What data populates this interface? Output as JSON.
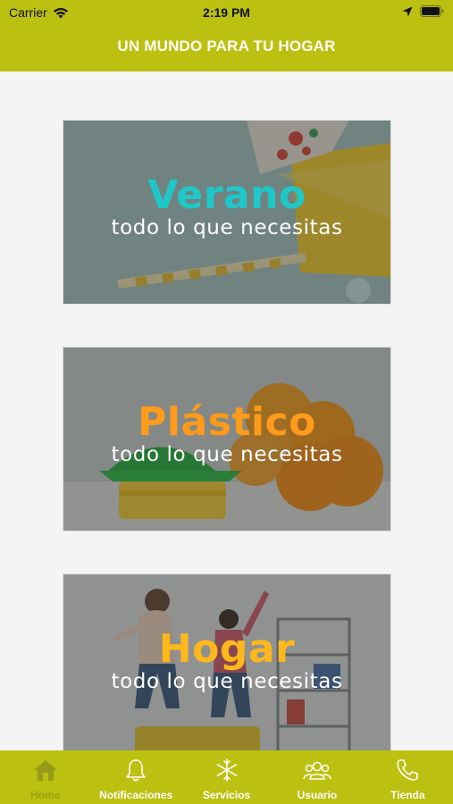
{
  "status": {
    "carrier": "Carrier",
    "time": "2:19 PM"
  },
  "header": {
    "title": "UN MUNDO PARA TU HOGAR"
  },
  "cards": [
    {
      "title": "Verano",
      "subtitle": "todo lo que necesitas",
      "title_color": "#1ec8c8"
    },
    {
      "title": "Plástico",
      "subtitle": "todo lo que necesitas",
      "title_color": "#ff9a1a"
    },
    {
      "title": "Hogar",
      "subtitle": "todo lo que necesitas",
      "title_color": "#ffb81c"
    }
  ],
  "tabbar": {
    "items": [
      {
        "label": "Home",
        "icon": "home-icon",
        "active": true
      },
      {
        "label": "Notificaciones",
        "icon": "bell-icon",
        "active": false
      },
      {
        "label": "Servicios",
        "icon": "asterisk-icon",
        "active": false
      },
      {
        "label": "Usuario",
        "icon": "users-icon",
        "active": false
      },
      {
        "label": "Tienda",
        "icon": "phone-icon",
        "active": false
      }
    ]
  },
  "colors": {
    "brand": "#bcc010",
    "background": "#f4f4f5"
  }
}
